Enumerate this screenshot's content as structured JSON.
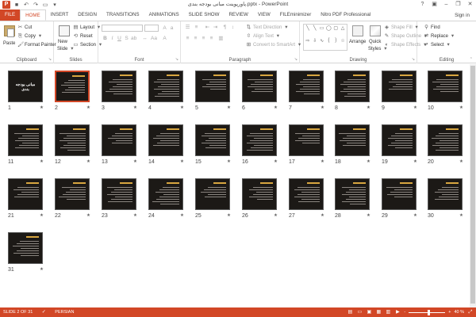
{
  "app": {
    "logo": "P",
    "title": "پاورپوینت مبانی بودجه بندی.pptx - PowerPoint",
    "sign_in": "Sign in"
  },
  "tabs": [
    {
      "label": "FILE"
    },
    {
      "label": "HOME"
    },
    {
      "label": "INSERT"
    },
    {
      "label": "DESIGN"
    },
    {
      "label": "TRANSITIONS"
    },
    {
      "label": "ANIMATIONS"
    },
    {
      "label": "SLIDE SHOW"
    },
    {
      "label": "REVIEW"
    },
    {
      "label": "VIEW"
    },
    {
      "label": "FILEminimizer"
    },
    {
      "label": "Nitro PDF Professional"
    }
  ],
  "ribbon": {
    "clipboard": {
      "paste": "Paste",
      "cut": "Cut",
      "copy": "Copy",
      "format_painter": "Format Painter",
      "label": "Clipboard"
    },
    "slides": {
      "new_slide_1": "New",
      "new_slide_2": "Slide",
      "layout": "Layout",
      "reset": "Reset",
      "section": "Section",
      "label": "Slides"
    },
    "font": {
      "label": "Font"
    },
    "paragraph": {
      "text_direction": "Text Direction",
      "align_text": "Align Text",
      "convert_smartart": "Convert to SmartArt",
      "label": "Paragraph"
    },
    "drawing": {
      "arrange": "Arrange",
      "quick_styles_1": "Quick",
      "quick_styles_2": "Styles",
      "shape_fill": "Shape Fill",
      "shape_outline": "Shape Outline",
      "shape_effects": "Shape Effects",
      "label": "Drawing"
    },
    "editing": {
      "find": "Find",
      "replace": "Replace",
      "select": "Select",
      "label": "Editing"
    }
  },
  "slides": [
    {
      "number": "1",
      "title": "مبانی بودجه بندی"
    },
    {
      "number": "2"
    },
    {
      "number": "3"
    },
    {
      "number": "4"
    },
    {
      "number": "5"
    },
    {
      "number": "6"
    },
    {
      "number": "7"
    },
    {
      "number": "8"
    },
    {
      "number": "9"
    },
    {
      "number": "10"
    },
    {
      "number": "11"
    },
    {
      "number": "12"
    },
    {
      "number": "13"
    },
    {
      "number": "14"
    },
    {
      "number": "15"
    },
    {
      "number": "16"
    },
    {
      "number": "17"
    },
    {
      "number": "18"
    },
    {
      "number": "19"
    },
    {
      "number": "20"
    },
    {
      "number": "21"
    },
    {
      "number": "22"
    },
    {
      "number": "23"
    },
    {
      "number": "24"
    },
    {
      "number": "25"
    },
    {
      "number": "26"
    },
    {
      "number": "27"
    },
    {
      "number": "28"
    },
    {
      "number": "29"
    },
    {
      "number": "30"
    },
    {
      "number": "31"
    }
  ],
  "selected_slide": 2,
  "status": {
    "slide_info": "SLIDE 2 OF 31",
    "language": "PERSIAN",
    "zoom": "40 %",
    "zoom_minus": "-",
    "zoom_plus": "+"
  },
  "icons": {
    "star": "★",
    "save": "💾",
    "undo": "↶",
    "redo": "↷",
    "help": "?",
    "minimize": "–",
    "restore": "❐",
    "close": "✕"
  },
  "colors": {
    "accent": "#d24726"
  }
}
